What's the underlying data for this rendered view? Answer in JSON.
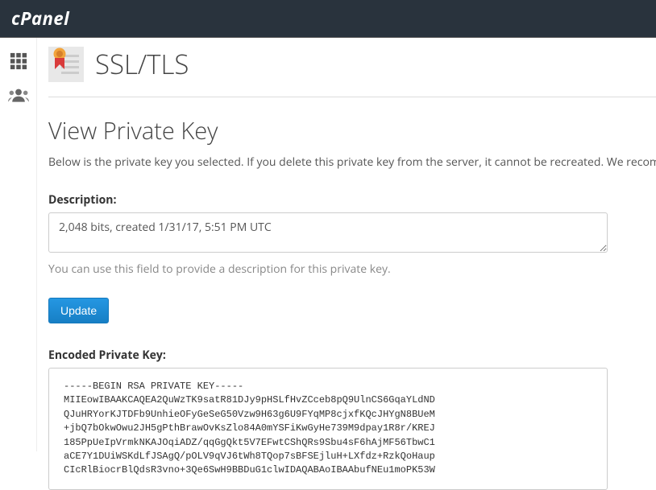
{
  "logo": "cPanel",
  "page_title": "SSL/TLS",
  "section_title": "View Private Key",
  "section_desc": "Below is the private key you selected. If you delete this private key from the server, it cannot be recreated. We recom",
  "description_label": "Description:",
  "description_value": "2,048 bits, created 1/31/17, 5:51 PM UTC",
  "description_help": "You can use this field to provide a description for this private key.",
  "update_label": "Update",
  "encoded_label": "Encoded Private Key:",
  "encoded_key": "-----BEGIN RSA PRIVATE KEY-----\nMIIEowIBAAKCAQEA2QuWzTK9satR81DJy9pHSLfHvZCceb8pQ9UlnCS6GqaYLdND\nQJuHRYorKJTDFb9UnhieOFyGeSeG50Vzw9H63g6U9FYqMP8cjxfKQcJHYgN8BUeM\n+jbQ7bOkwOwu2JH5gPthBrawOvKsZlo84A0mYSFiKwGyHe739M9dpay1R8r/KREJ\n185PpUeIpVrmkNKAJOqiADZ/qqGgQkt5V7EFwtCShQRs9Sbu4sF6hAjMF56TbwC1\naCE7Y1DUiWSKdLfJSAgQ/pOLV9qVJ6tWh8TQop7sBFSEjluH+LXfdz+RzkQoHaup\nCIcRlBiocrBlQdsR3vno+3Qe6SwH9BBDuG1clwIDAQABAoIBAAbufNEu1moPK53W"
}
